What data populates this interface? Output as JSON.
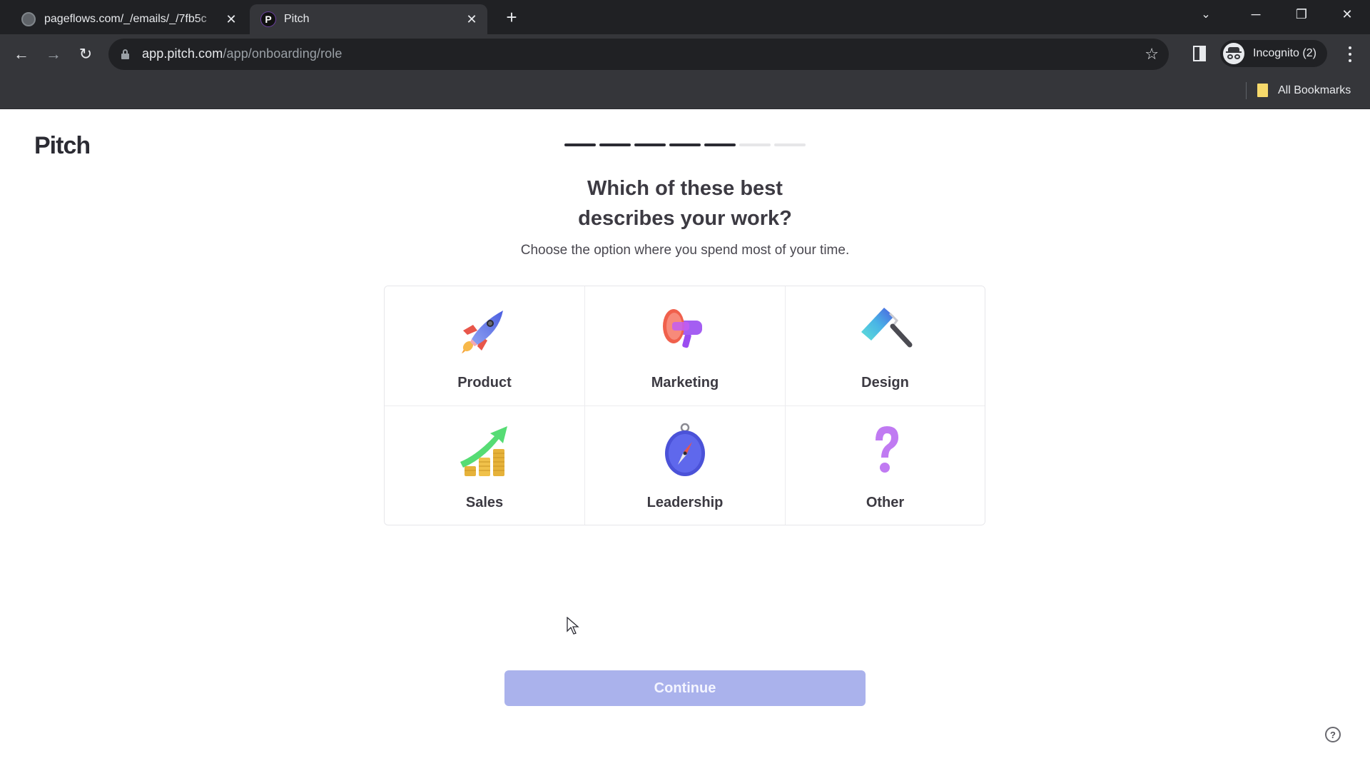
{
  "browser": {
    "tabs": [
      {
        "title": "pageflows.com/_/emails/_/7fb5c",
        "favicon": "globe-icon",
        "active": false
      },
      {
        "title": "Pitch",
        "favicon": "pitch-logo-icon",
        "active": true
      }
    ],
    "new_tab_label": "+",
    "url_host": "app.pitch.com",
    "url_path": "/app/onboarding/role",
    "profile_label": "Incognito (2)",
    "bookmarks_folder": "All Bookmarks",
    "window_controls": {
      "minimize": "─",
      "restore": "❐",
      "close": "✕",
      "tab_search": "⌄"
    }
  },
  "page": {
    "logo": "Pitch",
    "progress": {
      "completed_steps": 5,
      "total_steps": 7
    },
    "heading_line1": "Which of these best",
    "heading_line2": "describes your work?",
    "subtitle": "Choose the option where you spend most of your time.",
    "options": [
      {
        "label": "Product",
        "icon": "rocket-icon"
      },
      {
        "label": "Marketing",
        "icon": "megaphone-icon"
      },
      {
        "label": "Design",
        "icon": "paint-roller-icon"
      },
      {
        "label": "Sales",
        "icon": "growth-chart-coins-icon"
      },
      {
        "label": "Leadership",
        "icon": "compass-icon"
      },
      {
        "label": "Other",
        "icon": "question-mark-icon"
      }
    ],
    "continue_label": "Continue",
    "continue_color": "#aab2ec",
    "help_label": "?"
  }
}
